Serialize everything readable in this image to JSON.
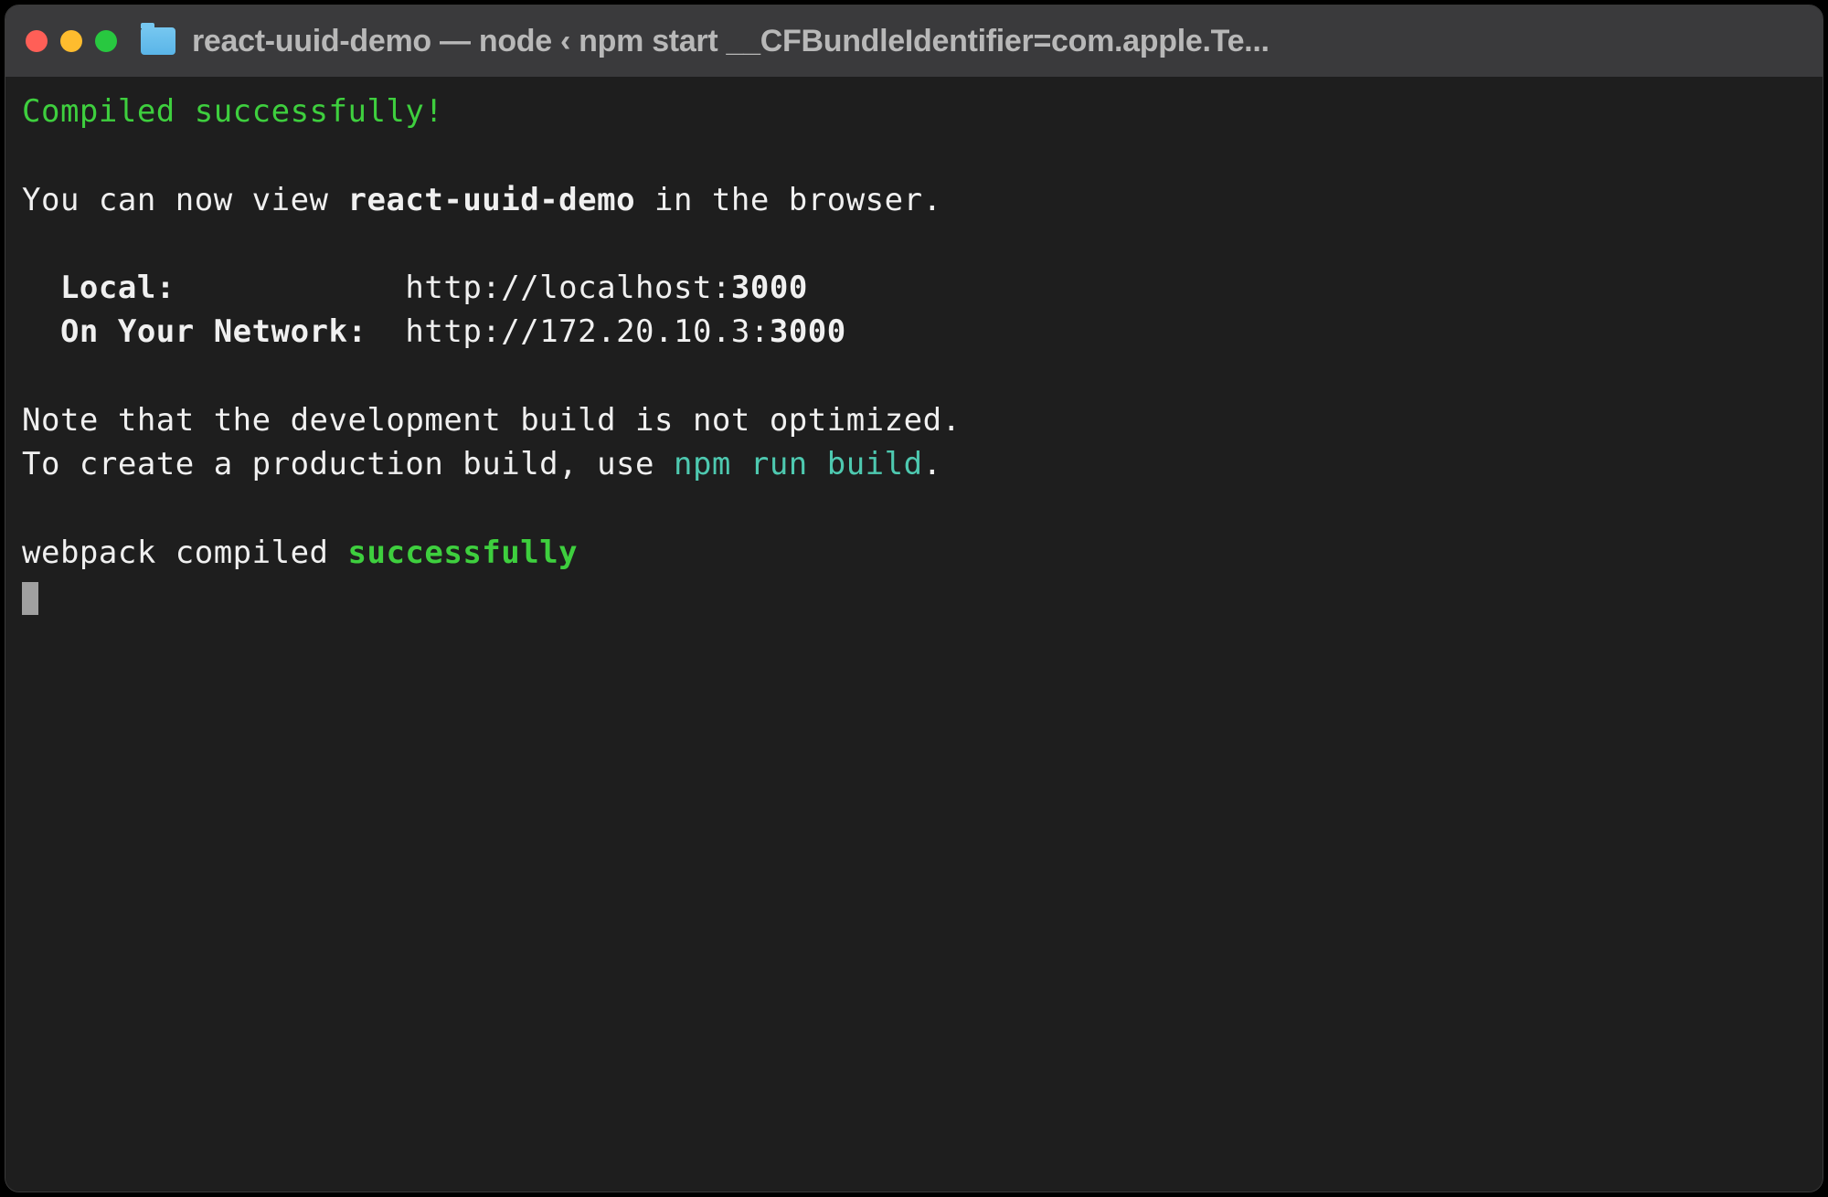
{
  "window": {
    "title": "react-uuid-demo — node ‹ npm start __CFBundleIdentifier=com.apple.Te..."
  },
  "terminal": {
    "compiled_success": "Compiled successfully!",
    "view_prefix": "You can now view ",
    "project_name": "react-uuid-demo",
    "view_suffix": " in the browser.",
    "local_label": "Local:",
    "local_url_prefix": "http://localhost:",
    "local_port": "3000",
    "network_label": "On Your Network:",
    "network_url_prefix": "http://172.20.10.3:",
    "network_port": "3000",
    "note_line1": "Note that the development build is not optimized.",
    "note_line2_prefix": "To create a production build, use ",
    "note_line2_cmd": "npm run build",
    "note_line2_suffix": ".",
    "webpack_prefix": "webpack compiled ",
    "webpack_status": "successfully"
  }
}
